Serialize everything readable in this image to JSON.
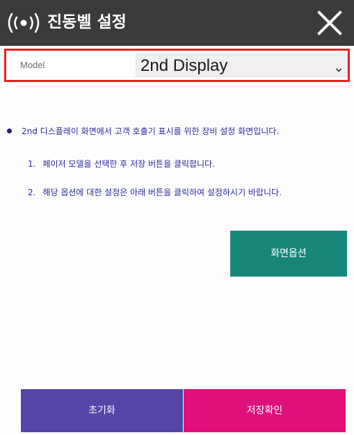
{
  "titlebar": {
    "title": "진동벨 설정",
    "icon": "vibration-signal-icon",
    "close_icon": "close-icon"
  },
  "model": {
    "label": "Model",
    "selected": "2nd Display"
  },
  "instructions": {
    "intro": "2nd 디스플레이 화면에서 고객 호출기 표시를 위한 장비 설정 화면입니다.",
    "steps": [
      {
        "num": "1.",
        "text": "페이저 모델을 선택한 후 저장 버튼을 클릭합니다."
      },
      {
        "num": "2.",
        "text": "해당 옵션에 대한 설정은 아래 버튼을 클릭하여 설정하시기 바랍니다."
      }
    ]
  },
  "buttons": {
    "screen_option": "화면옵션",
    "reset": "초기화",
    "save": "저장확인"
  },
  "colors": {
    "titlebar_bg": "#3b3b3d",
    "highlight_border": "#e8201f",
    "text_blue": "#2a2a9e",
    "screen_option_bg": "#17877a",
    "reset_bg": "#5446a8",
    "save_bg": "#e0107a"
  }
}
